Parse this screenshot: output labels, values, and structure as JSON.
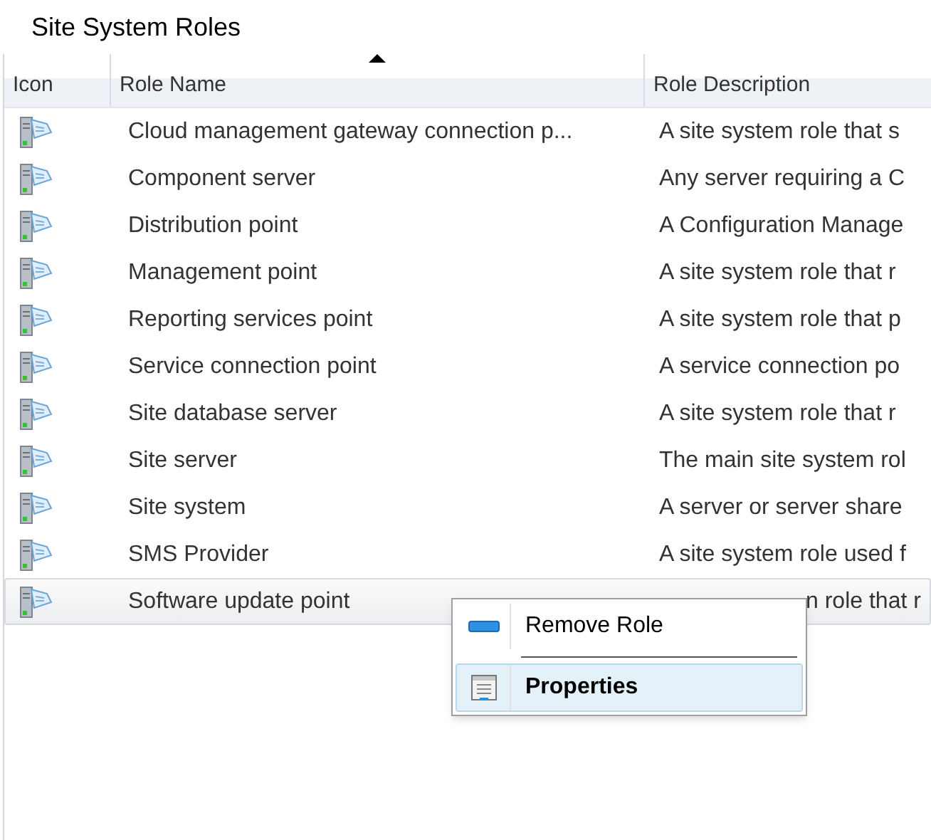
{
  "title": "Site System Roles",
  "table": {
    "columns": [
      {
        "label": "Icon",
        "sorted": false
      },
      {
        "label": "Role Name",
        "sorted": true
      },
      {
        "label": "Role Description",
        "sorted": false
      }
    ],
    "rows": [
      {
        "name": "Cloud management gateway connection p...",
        "description": "A site system role that s",
        "selected": false
      },
      {
        "name": "Component server",
        "description": "Any server requiring a C",
        "selected": false
      },
      {
        "name": "Distribution point",
        "description": "A Configuration Manage",
        "selected": false
      },
      {
        "name": "Management point",
        "description": "A site system role that r",
        "selected": false
      },
      {
        "name": "Reporting services point",
        "description": "A site system role that  p",
        "selected": false
      },
      {
        "name": "Service connection point",
        "description": "A service connection po",
        "selected": false
      },
      {
        "name": "Site database server",
        "description": "A site system role that r",
        "selected": false
      },
      {
        "name": "Site server",
        "description": "The main site system rol",
        "selected": false
      },
      {
        "name": "Site system",
        "description": "A server or server share",
        "selected": false
      },
      {
        "name": "SMS Provider",
        "description": "A site system role used f",
        "selected": false
      },
      {
        "name": "Software update point",
        "description": "n role that r",
        "selected": true
      }
    ]
  },
  "context_menu": {
    "items": [
      {
        "kind": "remove",
        "label": "Remove Role",
        "selected": false
      },
      {
        "kind": "properties",
        "label": "Properties",
        "selected": true
      }
    ]
  }
}
